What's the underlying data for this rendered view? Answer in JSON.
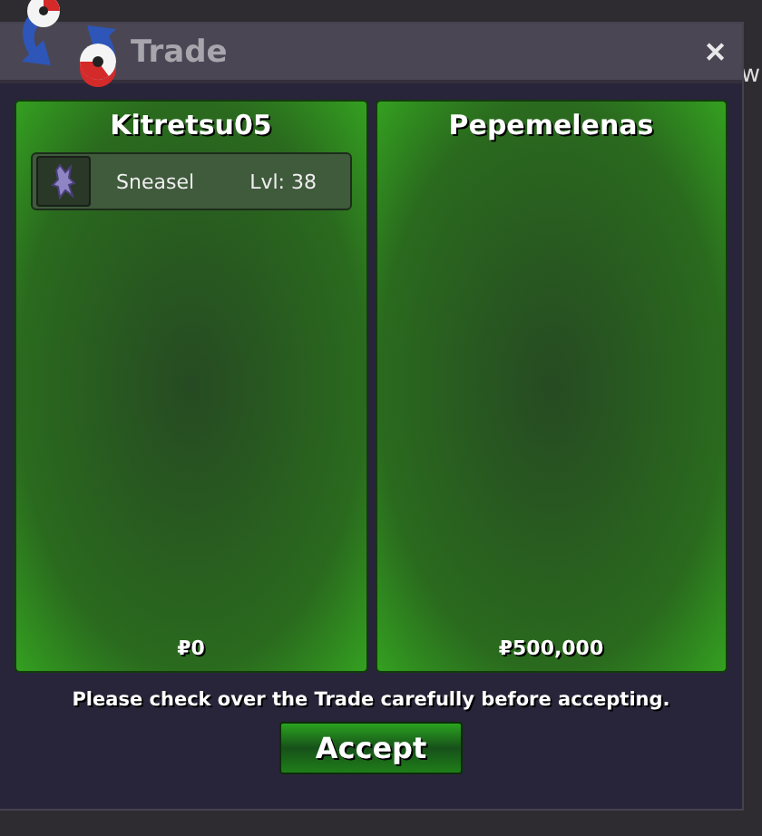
{
  "window": {
    "title": "Trade",
    "close": "✕"
  },
  "background_text": "w",
  "offers": [
    {
      "player": "Kitretsu05",
      "items": [
        {
          "name": "Sneasel",
          "level": "Lvl: 38"
        }
      ],
      "money": "₽0"
    },
    {
      "player": "Pepemelenas",
      "money": "₽500,000"
    }
  ],
  "notice": "Please check over the Trade carefully before accepting.",
  "accept_button": "Accept"
}
